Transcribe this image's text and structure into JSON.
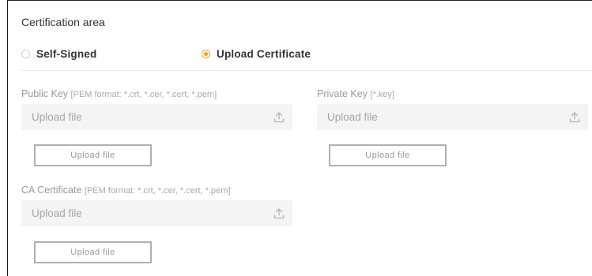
{
  "section": {
    "title": "Certification area"
  },
  "mode": {
    "options": [
      {
        "label": "Self-Signed",
        "selected": false
      },
      {
        "label": "Upload Certificate",
        "selected": true
      }
    ]
  },
  "public_key": {
    "label": "Public Key",
    "hint": "[PEM format: *.crt, *.cer, *.cert, *.pem]",
    "placeholder": "Upload file",
    "button": "Upload file"
  },
  "private_key": {
    "label": "Private Key",
    "hint": "[*.key]",
    "placeholder": "Upload file",
    "button": "Upload file"
  },
  "ca_certificate": {
    "label": "CA Certificate",
    "hint": "[PEM format: *.crt, *.cer, *.cert, *.pem]",
    "placeholder": "Upload file",
    "button": "Upload file"
  },
  "colors": {
    "accent": "#f2a31b",
    "muted_text": "#a6a6a6",
    "field_bg": "#f4f4f4"
  },
  "icons": {
    "upload": "upload-icon"
  }
}
